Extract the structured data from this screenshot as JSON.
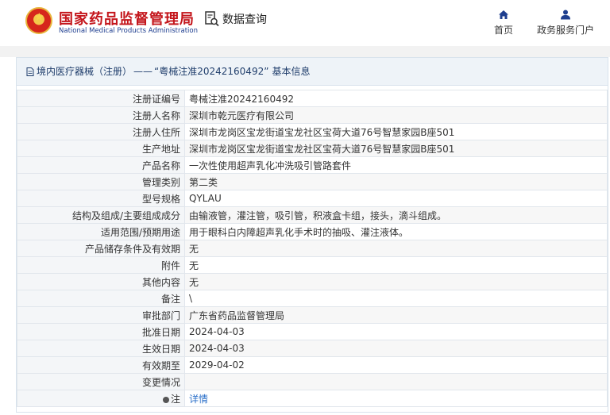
{
  "header": {
    "org_cn": "国家药品监督管理局",
    "org_en": "National Medical Products Administration",
    "search_label": "数据查询",
    "nav": [
      {
        "label": "首页",
        "icon": "home-icon"
      },
      {
        "label": "政务服务门户",
        "icon": "user-icon"
      }
    ]
  },
  "breadcrumb": {
    "category": "境内医疗器械（注册）",
    "separator": "——",
    "record": "“粤械注准20242160492”",
    "suffix": "基本信息"
  },
  "fields": [
    {
      "label": "注册证编号",
      "value": "粤械注准20242160492"
    },
    {
      "label": "注册人名称",
      "value": "深圳市乾元医疗有限公司"
    },
    {
      "label": "注册人住所",
      "value": "深圳市龙岗区宝龙街道宝龙社区宝荷大道76号智慧家园B座501"
    },
    {
      "label": "生产地址",
      "value": "深圳市龙岗区宝龙街道宝龙社区宝荷大道76号智慧家园B座501"
    },
    {
      "label": "产品名称",
      "value": "一次性使用超声乳化冲洗吸引管路套件"
    },
    {
      "label": "管理类别",
      "value": "第二类"
    },
    {
      "label": "型号规格",
      "value": "QYLAU"
    },
    {
      "label": "结构及组成/主要组成成分",
      "value": "由输液管，灌注管，吸引管，积液盒卡组，接头，滴斗组成。"
    },
    {
      "label": "适用范围/预期用途",
      "value": "用于眼科白内障超声乳化手术时的抽吸、灌注液体。"
    },
    {
      "label": "产品储存条件及有效期",
      "value": "无"
    },
    {
      "label": "附件",
      "value": "无"
    },
    {
      "label": "其他内容",
      "value": "无"
    },
    {
      "label": "备注",
      "value": "\\"
    },
    {
      "label": "审批部门",
      "value": "广东省药品监督管理局"
    },
    {
      "label": "批准日期",
      "value": "2024-04-03"
    },
    {
      "label": "生效日期",
      "value": "2024-04-03"
    },
    {
      "label": "有效期至",
      "value": "2029-04-02"
    },
    {
      "label": "变更情况",
      "value": ""
    }
  ],
  "note": {
    "label": "注",
    "link": "详情"
  }
}
